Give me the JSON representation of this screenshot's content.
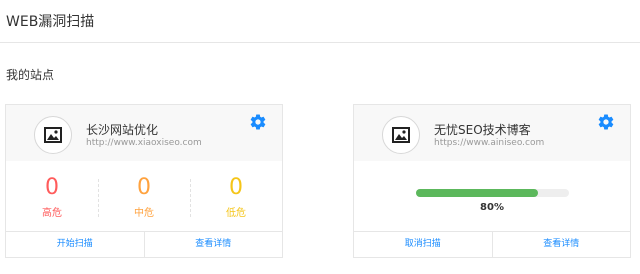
{
  "header": {
    "title": "WEB漏洞扫描"
  },
  "section": {
    "title": "我的站点"
  },
  "colors": {
    "high": "#ff5b5b",
    "medium": "#ffa23e",
    "low": "#f5c518",
    "accent": "#1a8cff",
    "progress": "#5cb85c"
  },
  "sites": [
    {
      "name": "长沙网站优化",
      "url": "http://www.xiaoxiseo.com",
      "stats": [
        {
          "value": "0",
          "label": "高危"
        },
        {
          "value": "0",
          "label": "中危"
        },
        {
          "value": "0",
          "label": "低危"
        }
      ],
      "actions": [
        "开始扫描",
        "查看详情"
      ]
    },
    {
      "name": "无忧SEO技术博客",
      "url": "https://www.ainiseo.com",
      "progress": 0.8,
      "progress_label": "80%",
      "actions": [
        "取消扫描",
        "查看详情"
      ]
    }
  ]
}
